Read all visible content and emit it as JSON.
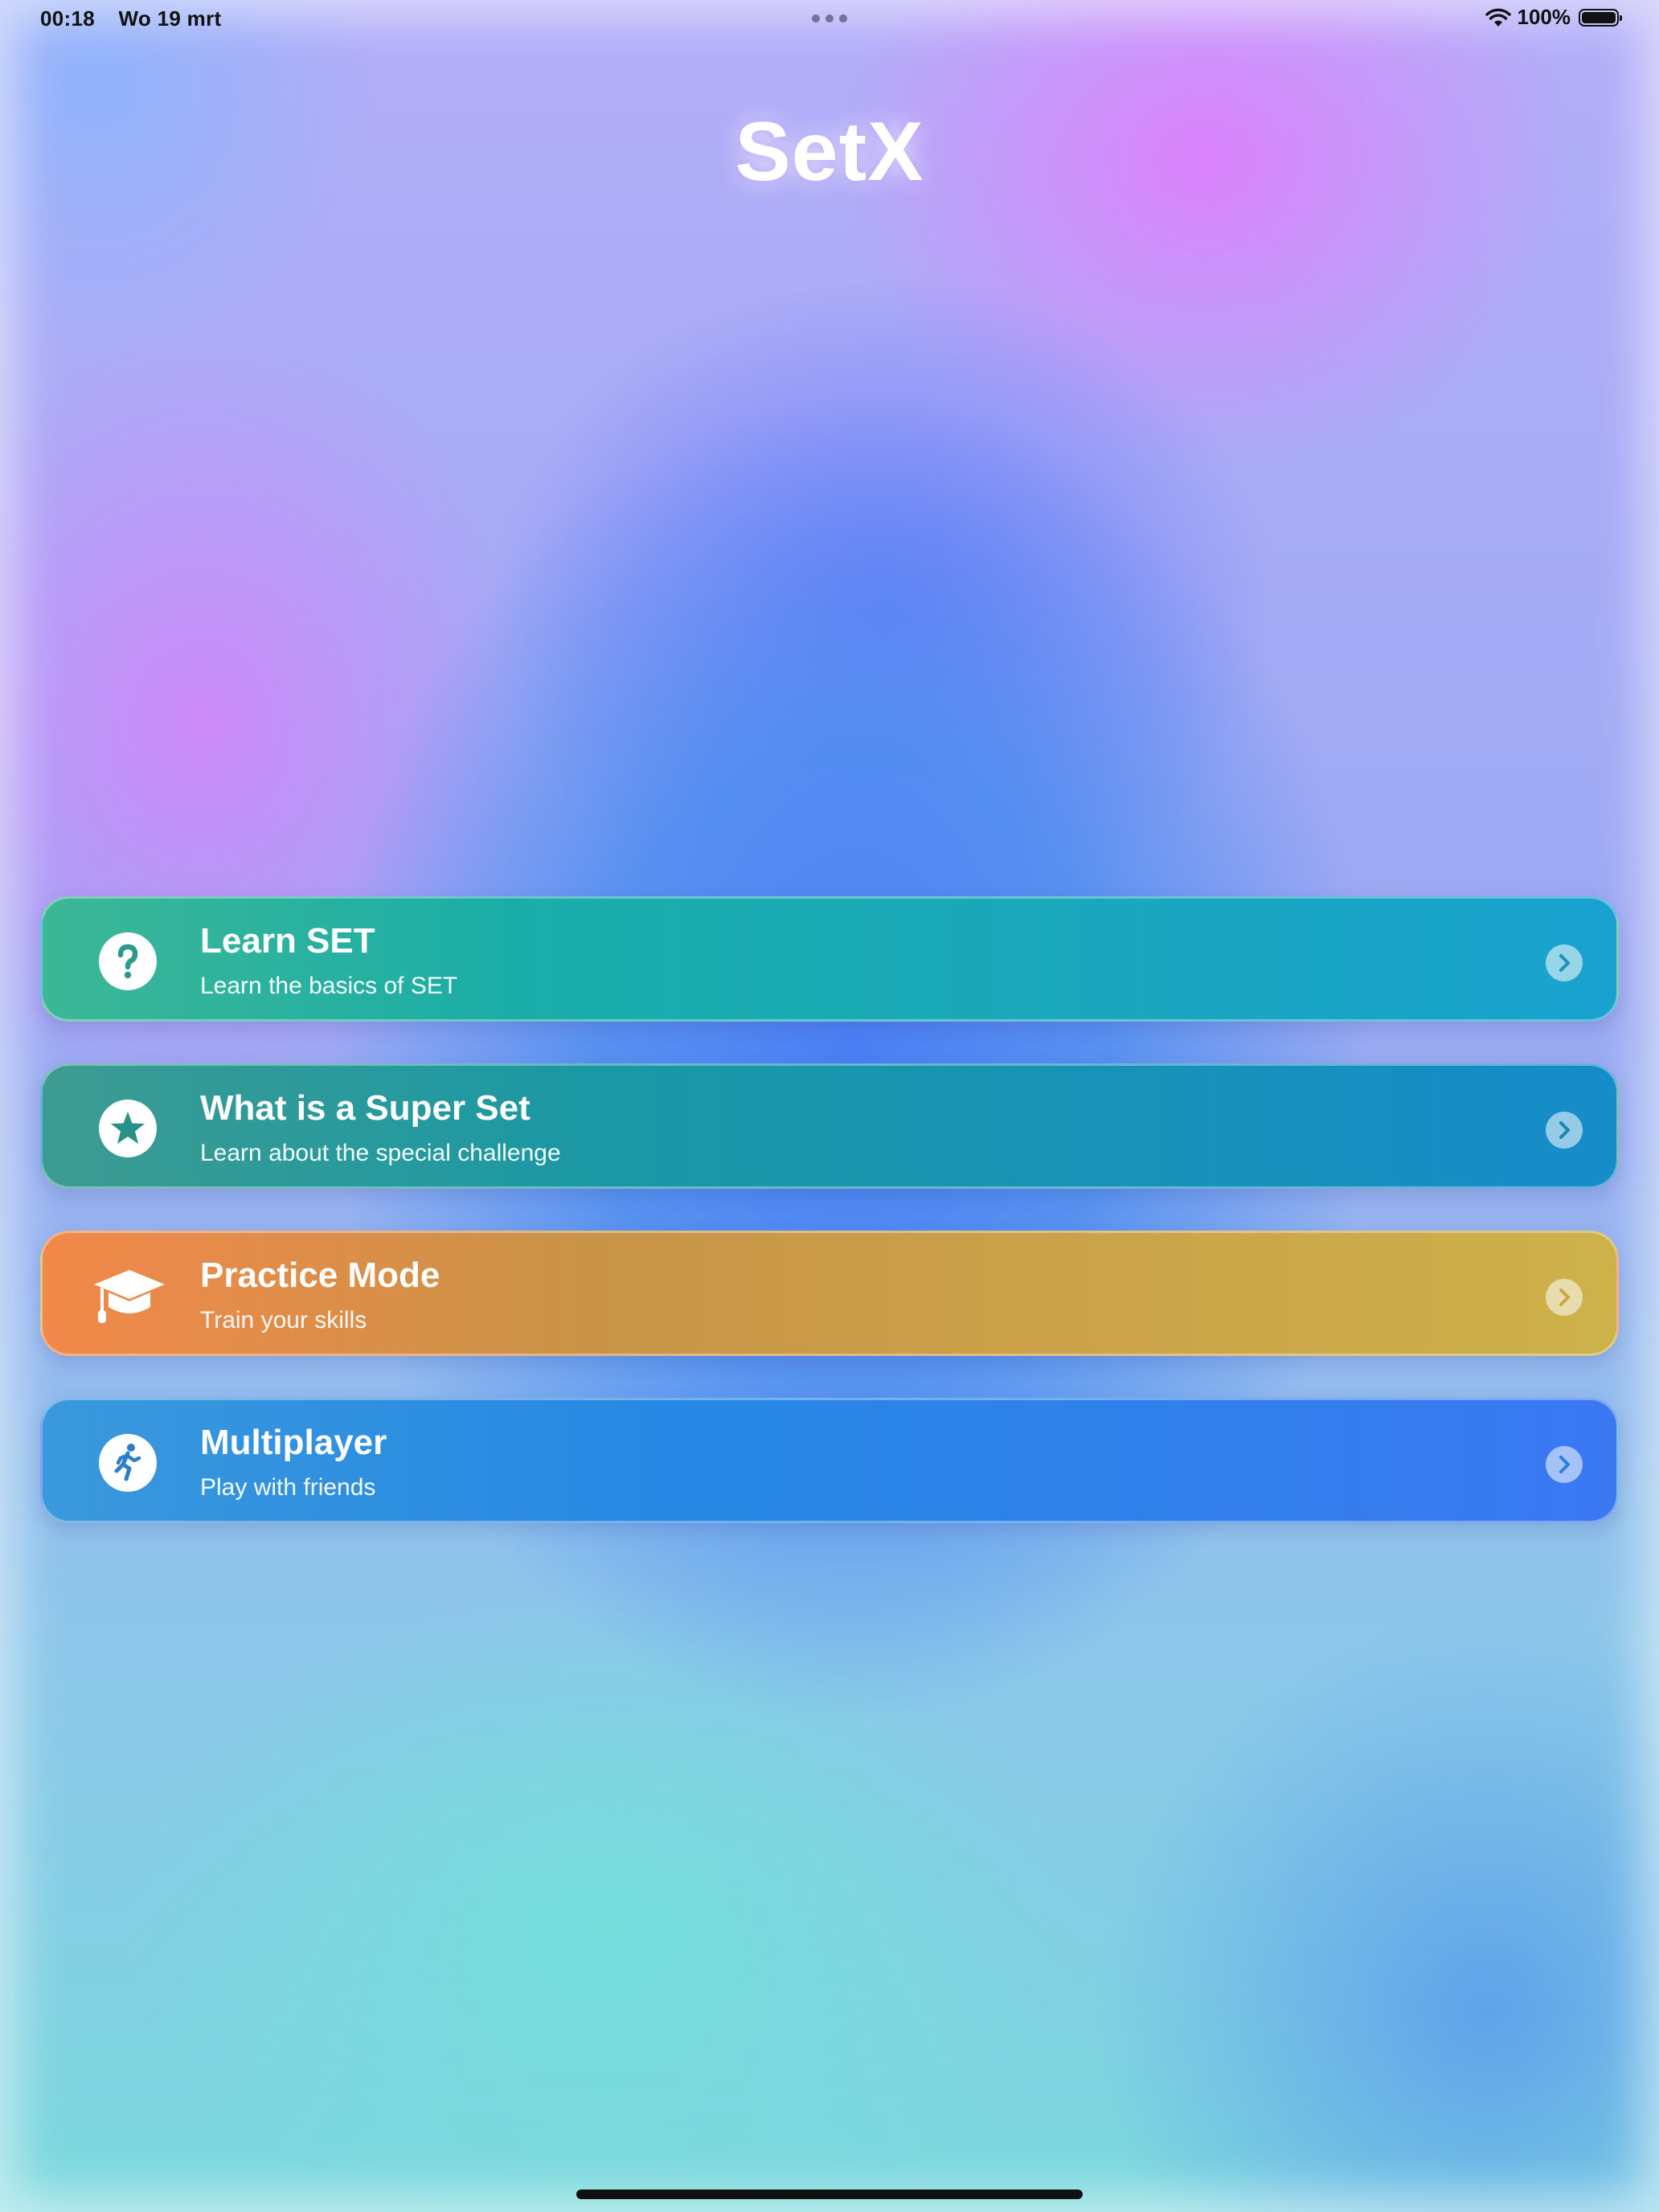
{
  "status_bar": {
    "time": "00:18",
    "date": "Wo 19 mrt",
    "battery_text": "100%"
  },
  "app": {
    "title": "SetX"
  },
  "menu": [
    {
      "title": "Learn SET",
      "subtitle": "Learn the basics of SET",
      "icon": "question-mark-icon",
      "color": "#1aada8"
    },
    {
      "title": "What is a Super Set",
      "subtitle": "Learn about the special challenge",
      "icon": "star-icon",
      "color": "#1a98a4"
    },
    {
      "title": "Practice Mode",
      "subtitle": "Train your skills",
      "icon": "graduation-cap-icon",
      "color": "#c99448"
    },
    {
      "title": "Multiplayer",
      "subtitle": "Play with friends",
      "icon": "running-person-icon",
      "color": "#2688e4"
    }
  ]
}
